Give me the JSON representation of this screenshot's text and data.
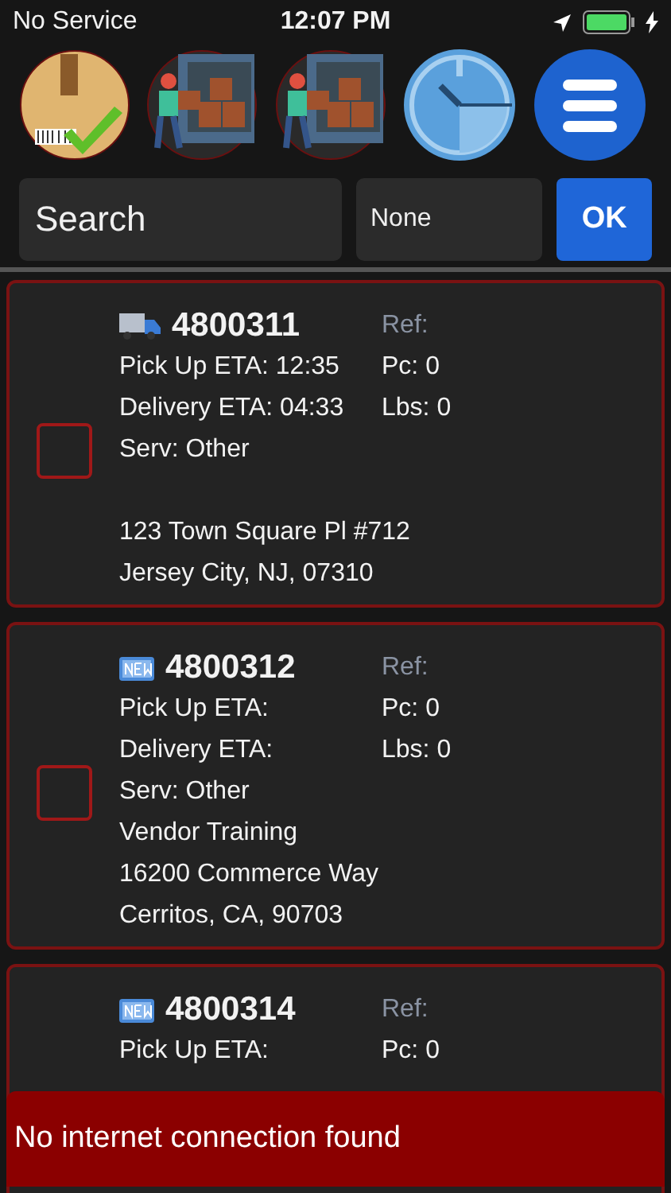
{
  "status_bar": {
    "carrier": "No Service",
    "time": "12:07 PM",
    "charging": true
  },
  "toolbar": [
    {
      "kind": "package"
    },
    {
      "kind": "loading"
    },
    {
      "kind": "loading"
    },
    {
      "kind": "timer"
    },
    {
      "kind": "menu"
    }
  ],
  "search": {
    "placeholder": "Search",
    "filter": "None",
    "button": "OK"
  },
  "orders": [
    {
      "kind": "truck",
      "number": "4800311",
      "ref": "Ref:",
      "pickup": "Pick Up ETA: 12:35",
      "pieces": "Pc: 0",
      "delivery": "Delivery ETA: 04:33",
      "weight": "Lbs: 0",
      "service": "Serv: Other",
      "address": "123 Town Square Pl #712",
      "city": "Jersey City, NJ, 07310",
      "checked": false
    },
    {
      "kind": "new",
      "number": "4800312",
      "ref": "Ref:",
      "pickup": "Pick Up ETA:",
      "pieces": "Pc: 0",
      "delivery": "Delivery ETA:",
      "weight": "Lbs: 0",
      "service": "Serv: Other",
      "name": "Vendor Training",
      "address": "16200 Commerce Way",
      "city": "Cerritos, CA, 90703",
      "checked": false
    },
    {
      "kind": "new",
      "number": "4800314",
      "ref": "Ref:",
      "pickup": "Pick Up ETA:",
      "pieces": "Pc: 0"
    }
  ],
  "toast": {
    "message": "No internet connection found"
  }
}
